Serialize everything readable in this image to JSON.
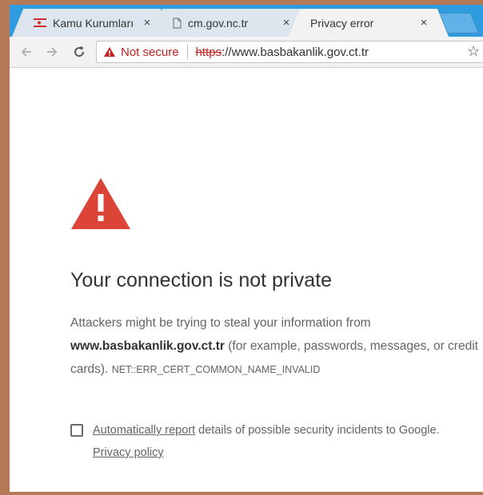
{
  "tabs": [
    {
      "label": "Kamu Kurumları",
      "close": "×",
      "icon": "flag-icon"
    },
    {
      "label": "cm.gov.nc.tr",
      "close": "×",
      "icon": "document-icon"
    },
    {
      "label": "Privacy error",
      "close": "×",
      "active": true
    }
  ],
  "toolbar": {
    "security_label": "Not secure",
    "url_scheme": "https",
    "url_rest": "://www.basbakanlik.gov.ct.tr"
  },
  "error": {
    "heading": "Your connection is not private",
    "text_before": "Attackers might be trying to steal your information from ",
    "host": "www.basbakanlik.gov.ct.tr",
    "text_after": " (for example, passwords, messages, or credit cards). ",
    "code": "NET::ERR_CERT_COMMON_NAME_INVALID"
  },
  "report": {
    "link": "Automatically report",
    "text": " details of possible security incidents to Google.",
    "privacy": "Privacy policy"
  },
  "colors": {
    "tabstrip": "#2f9ce0",
    "warning_red": "#db4437",
    "not_secure_red": "#c5221f",
    "frame": "#b57a55"
  }
}
